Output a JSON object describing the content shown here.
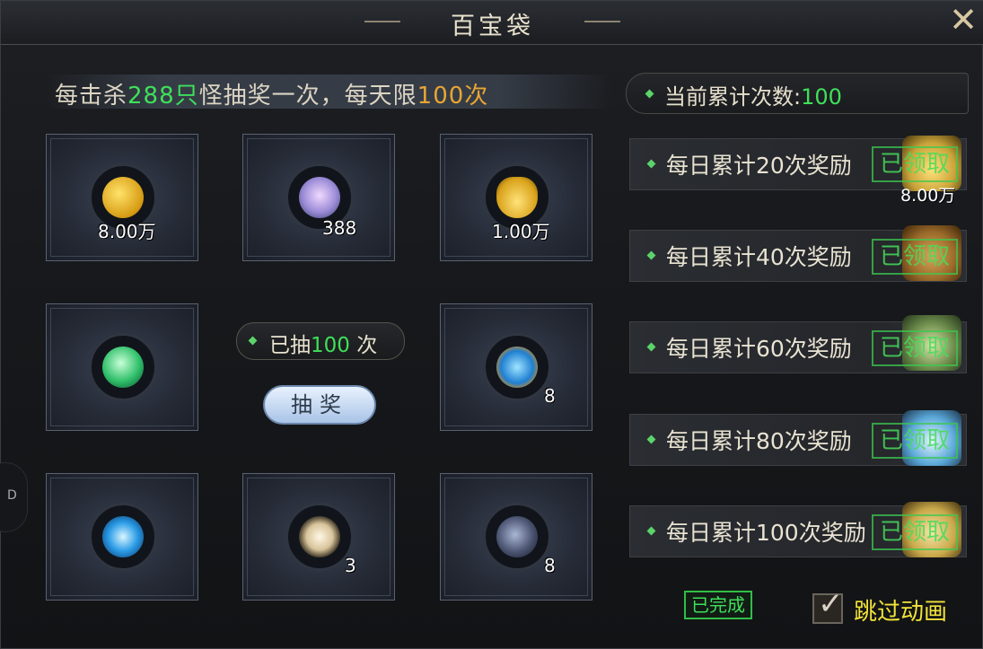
{
  "window": {
    "title": "百宝袋",
    "close_icon": "close-x-icon"
  },
  "banner": {
    "prefix": "每击杀",
    "kills": "288只",
    "middle": "怪抽奖一次，每天限",
    "limit": "100次"
  },
  "count": {
    "label": "当前累计次数:",
    "value": "100"
  },
  "items": [
    {
      "name": "gold-coins-icon",
      "qty": "8.00万"
    },
    {
      "name": "spirit-orb-icon",
      "qty": "388"
    },
    {
      "name": "gold-ingot-icon",
      "qty": "1.00万"
    },
    {
      "name": "jade-orb-icon",
      "qty": ""
    },
    {
      "name": "water-gem-icon",
      "qty": "8"
    },
    {
      "name": "blue-crystal-orb-icon",
      "qty": ""
    },
    {
      "name": "wing-feather-icon",
      "qty": "3"
    },
    {
      "name": "dark-ore-icon",
      "qty": "8"
    }
  ],
  "draw": {
    "prefix": "已抽",
    "value": "100",
    "suffix": " 次",
    "button": "抽奖"
  },
  "rewards": [
    {
      "label": "每日累计20次奖励",
      "claimed": "已领取",
      "qty": "8.00万",
      "icon": "gold-ingot-chest-icon",
      "color": "#caa43a"
    },
    {
      "label": "每日累计40次奖励",
      "claimed": "已领取",
      "qty": "",
      "icon": "bronze-chest-icon",
      "color": "#9a6a2a"
    },
    {
      "label": "每日累计60次奖励",
      "claimed": "已领取",
      "qty": "",
      "icon": "jade-chest-icon",
      "color": "#6a8a4a"
    },
    {
      "label": "每日累计80次奖励",
      "claimed": "已领取",
      "qty": "",
      "icon": "crystal-chest-icon",
      "color": "#5aa8d8"
    },
    {
      "label": "每日累计100次奖励",
      "claimed": "已领取",
      "qty": "",
      "icon": "golden-chest-icon",
      "color": "#c9a84a"
    }
  ],
  "status": {
    "done": "已完成"
  },
  "skip": {
    "label": "跳过动画",
    "checked": true
  },
  "side_tab": {
    "label": "D"
  }
}
